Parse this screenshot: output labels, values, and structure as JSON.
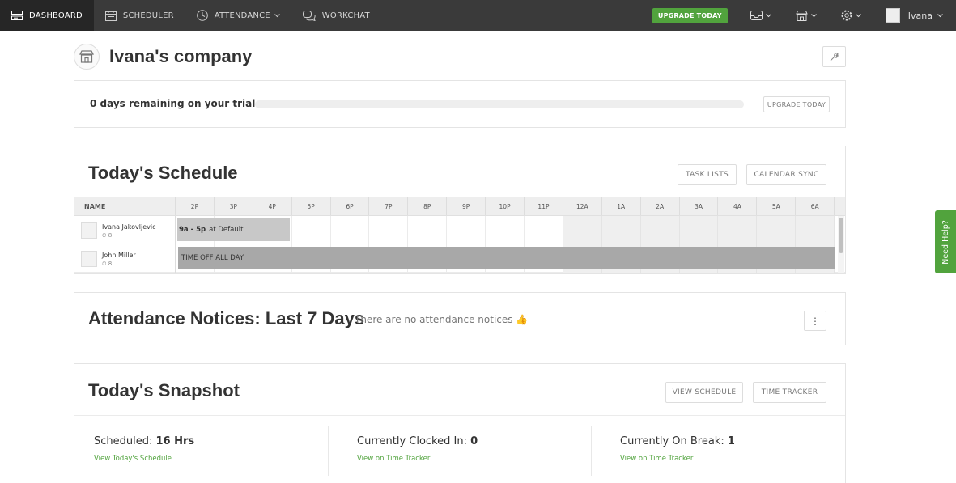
{
  "nav": {
    "items": [
      {
        "label": "DASHBOARD",
        "icon": "dashboard-icon"
      },
      {
        "label": "SCHEDULER",
        "icon": "calendar-icon"
      },
      {
        "label": "ATTENDANCE",
        "icon": "clock-icon"
      },
      {
        "label": "WORKCHAT",
        "icon": "chat-icon"
      }
    ],
    "upgrade_label": "UPGRADE TODAY",
    "user_name": "Ivana"
  },
  "company": {
    "name": "Ivana's company"
  },
  "trial": {
    "text": "0 days remaining on your trial",
    "progress": 0,
    "upgrade_label": "UPGRADE TODAY"
  },
  "schedule": {
    "title": "Today's Schedule",
    "task_lists_label": "TASK LISTS",
    "calendar_sync_label": "CALENDAR SYNC",
    "name_header": "NAME",
    "hours": [
      "2P",
      "3P",
      "4P",
      "5P",
      "6P",
      "7P",
      "8P",
      "9P",
      "10P",
      "11P",
      "12A",
      "1A",
      "2A",
      "3A",
      "4A",
      "5A",
      "6A"
    ],
    "employees": [
      {
        "name": "Ivana Jakovljevic",
        "hours": "8",
        "shift_time": "9a - 5p",
        "shift_location": "at Default"
      },
      {
        "name": "John Miller",
        "hours": "8",
        "timeoff": "TIME OFF ALL DAY"
      }
    ]
  },
  "attendance": {
    "title_bold": "Attendance Notices:",
    "title_rest": " Last 7 Days",
    "note": "There are no attendance notices 👍",
    "menu_label": "⋮"
  },
  "snapshot": {
    "title": "Today's Snapshot",
    "view_schedule_label": "VIEW SCHEDULE",
    "time_tracker_label": "TIME TRACKER",
    "stats": [
      {
        "label": "Scheduled: ",
        "value": "16 Hrs",
        "link": "View Today's Schedule"
      },
      {
        "label": "Currently Clocked In: ",
        "value": "0",
        "link": "View on Time Tracker"
      },
      {
        "label": "Currently On Break: ",
        "value": "1",
        "link": "View on Time Tracker"
      }
    ]
  },
  "help": {
    "label": "Need Help?"
  },
  "colors": {
    "nav_bg": "#3a3a3a",
    "accent_green": "#51a33d",
    "shift_bg": "#c8c8c8",
    "timeoff_bg": "#a8a8a8"
  }
}
